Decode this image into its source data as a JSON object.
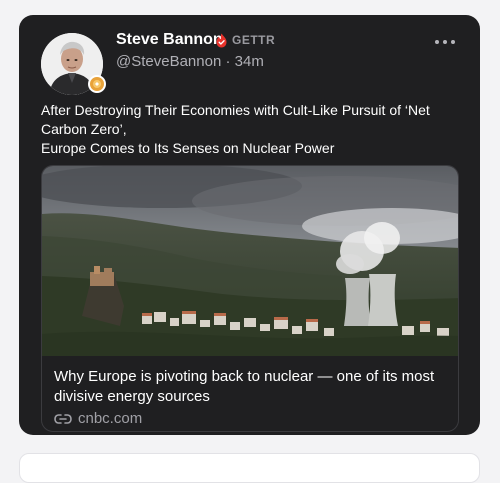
{
  "post": {
    "author_name": "Steve Bannon",
    "platform": "GETTR",
    "handle": "@SteveBannon",
    "separator": "·",
    "time_ago": "34m",
    "text_lines": [
      "After Destroying Their Economies with Cult-Like Pursuit of ‘Net",
      "Carbon Zero’,",
      "Europe Comes to Its Senses on Nuclear Power"
    ],
    "link_preview": {
      "title_lines": [
        "Why Europe is pivoting back to nuclear — one of its most",
        "divisive energy sources"
      ],
      "domain": "cnbc.com"
    }
  },
  "icons": {
    "verified": "verified-flame-icon",
    "more": "more-options-icon",
    "link": "link-icon",
    "badge": "badge-icon"
  },
  "colors": {
    "card_background": "#1f1f21",
    "page_background": "#f3f3f5",
    "verified_red": "#e8322b",
    "badge_orange": "#e8a23a"
  }
}
